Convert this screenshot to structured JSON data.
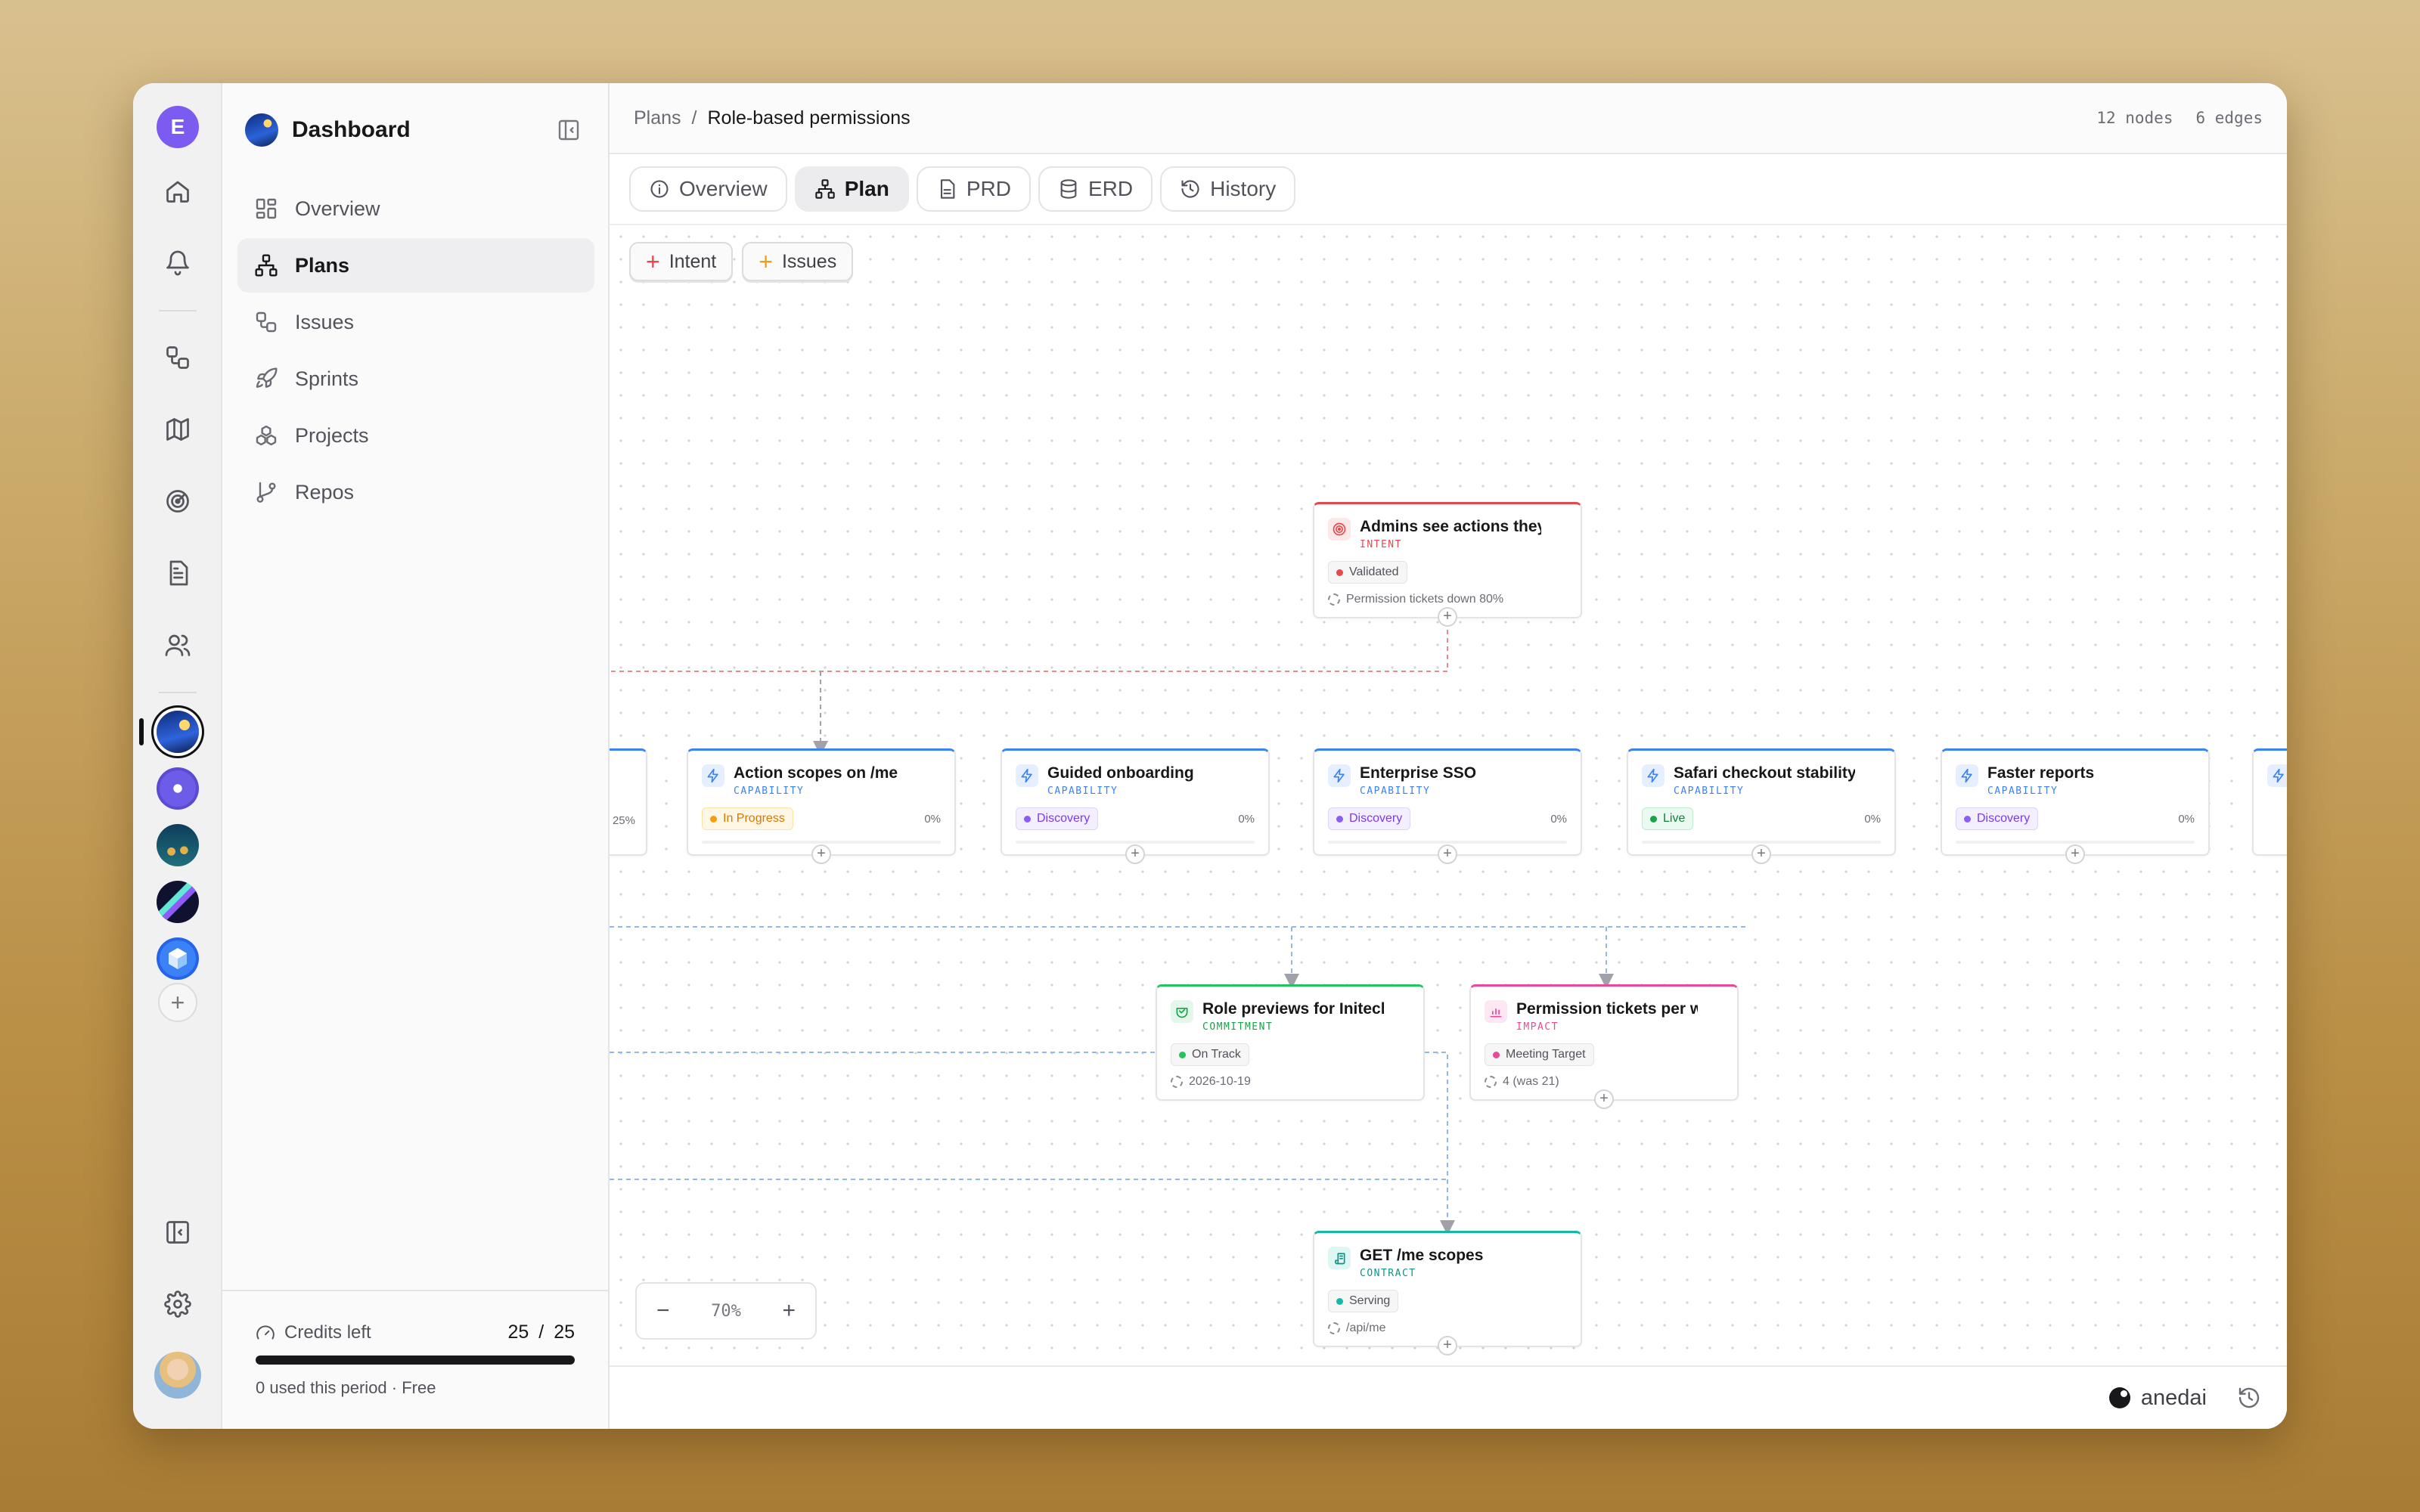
{
  "rail": {
    "user_initial": "E"
  },
  "sidebar": {
    "title": "Dashboard",
    "items": [
      {
        "label": "Overview",
        "icon": "layout-dashboard-icon"
      },
      {
        "label": "Plans",
        "icon": "network-icon",
        "active": true
      },
      {
        "label": "Issues",
        "icon": "issues-icon"
      },
      {
        "label": "Sprints",
        "icon": "rocket-icon"
      },
      {
        "label": "Projects",
        "icon": "boxes-icon"
      },
      {
        "label": "Repos",
        "icon": "git-branch-icon"
      }
    ],
    "credits": {
      "label": "Credits left",
      "used": "25",
      "sep": "/",
      "total": "25",
      "remaining_fraction": 1.0,
      "subtitle": "0 used this period · Free"
    }
  },
  "header": {
    "breadcrumb_root": "Plans",
    "breadcrumb_sep": "/",
    "breadcrumb_current": "Role-based permissions",
    "nodes_count": "12 nodes",
    "edges_count": "6 edges"
  },
  "tabs": [
    {
      "label": "Overview"
    },
    {
      "label": "Plan",
      "active": true
    },
    {
      "label": "PRD"
    },
    {
      "label": "ERD"
    },
    {
      "label": "History"
    }
  ],
  "chips": {
    "intent": "Intent",
    "issues": "Issues"
  },
  "nodes": {
    "intent": {
      "title": "Admins see actions they can take",
      "type": "INTENT",
      "status": "Validated",
      "meta": "Permission tickets down 80%"
    },
    "partial": {
      "pct": "25%"
    },
    "cap1": {
      "title": "Action scopes on /me",
      "type": "CAPABILITY",
      "status": "In Progress",
      "pct": "0%"
    },
    "cap2": {
      "title": "Guided onboarding",
      "type": "CAPABILITY",
      "status": "Discovery",
      "pct": "0%"
    },
    "cap3": {
      "title": "Enterprise SSO",
      "type": "CAPABILITY",
      "status": "Discovery",
      "pct": "0%"
    },
    "cap4": {
      "title": "Safari checkout stability",
      "type": "CAPABILITY",
      "status": "Live",
      "pct": "0%"
    },
    "cap5": {
      "title": "Faster reports",
      "type": "CAPABILITY",
      "status": "Discovery",
      "pct": "0%"
    },
    "commit": {
      "title": "Role previews for Initech",
      "type": "COMMITMENT",
      "status": "On Track",
      "meta": "2026-10-19"
    },
    "impact": {
      "title": "Permission tickets per week",
      "type": "IMPACT",
      "status": "Meeting Target",
      "meta": "4 (was 21)"
    },
    "contract": {
      "title": "GET /me scopes",
      "type": "CONTRACT",
      "status": "Serving",
      "meta": "/api/me"
    }
  },
  "colors": {
    "intent": "#e5484d",
    "capability": "#3b82f6",
    "commitment": "#22c55e",
    "impact": "#ec4899",
    "contract": "#14b8a6",
    "in_progress": "#f59e0b",
    "discovery": "#8b5cf6",
    "live": "#16a34a"
  },
  "zoom": {
    "minus": "−",
    "level": "70%",
    "plus": "+"
  },
  "footer": {
    "brand": "anedai"
  }
}
